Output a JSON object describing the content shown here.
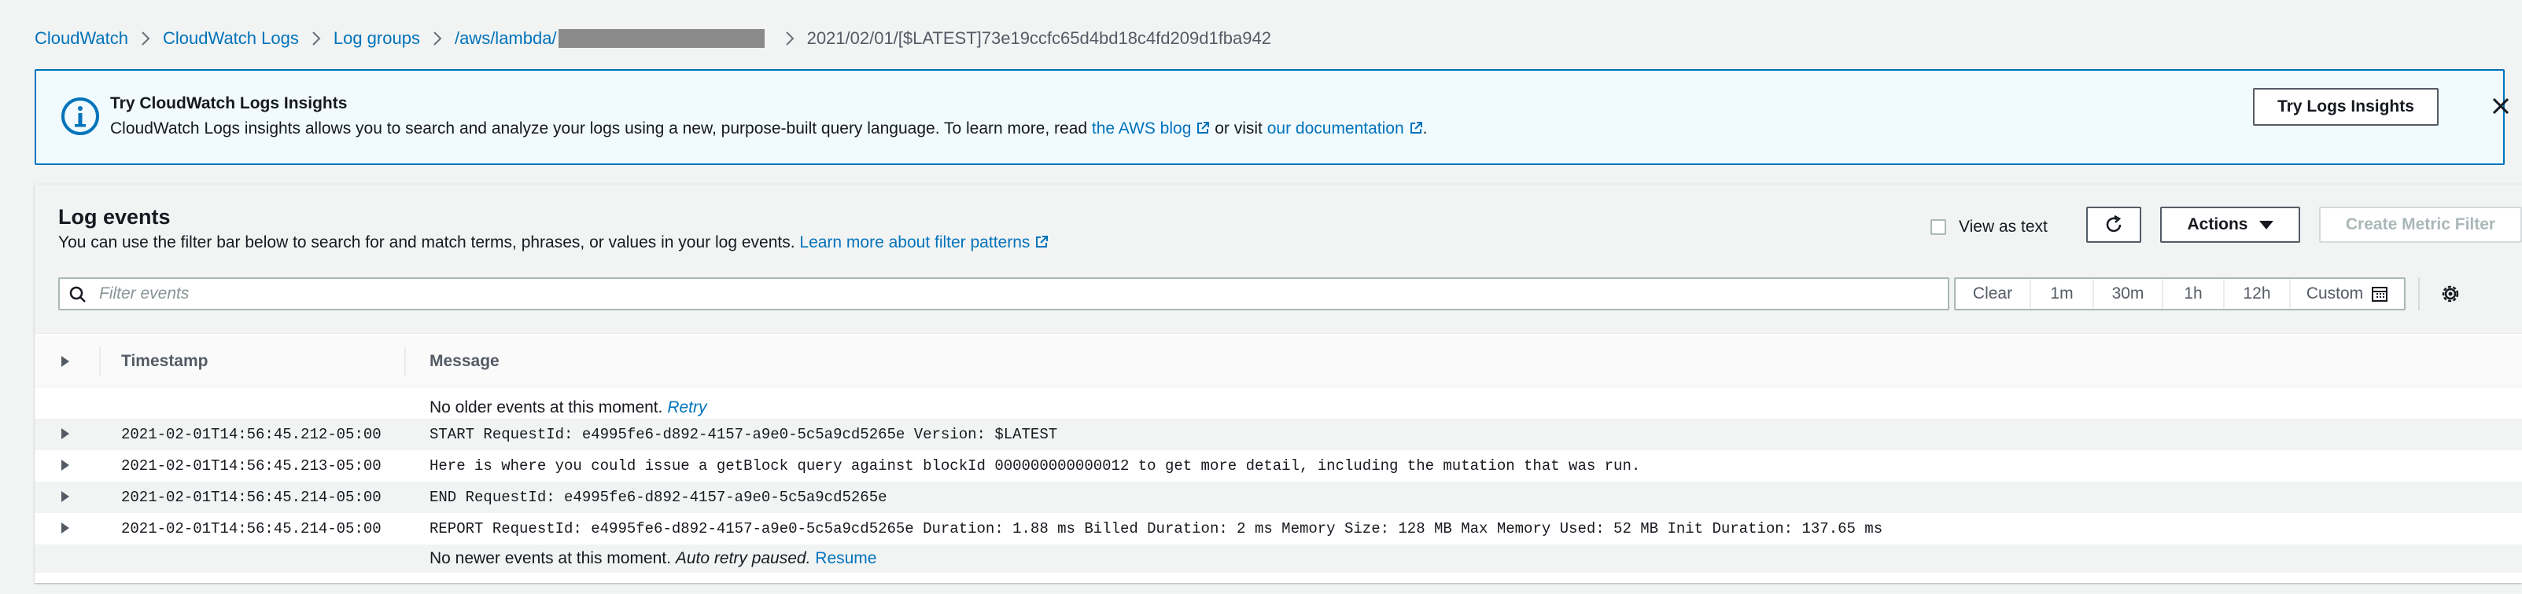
{
  "breadcrumb": {
    "items": [
      "CloudWatch",
      "CloudWatch Logs",
      "Log groups",
      "/aws/lambda/"
    ],
    "current": "2021/02/01/[$LATEST]73e19ccfc65d4bd18c4fd209d1fba942"
  },
  "banner": {
    "title": "Try CloudWatch Logs Insights",
    "body_prefix": "CloudWatch Logs insights allows you to search and analyze your logs using a new, purpose-built query language. To learn more, read ",
    "link1": "the AWS blog",
    "middle": " or visit ",
    "link2": "our documentation",
    "suffix": ".",
    "button": "Try Logs Insights"
  },
  "log_events": {
    "title": "Log events",
    "description": "You can use the filter bar below to search for and match terms, phrases, or values in your log events. ",
    "learn_more": "Learn more about filter patterns",
    "view_as_text": "View as text",
    "actions": "Actions",
    "create_metric_filter": "Create Metric Filter",
    "filter_placeholder": "Filter events",
    "time_ranges": [
      "Clear",
      "1m",
      "30m",
      "1h",
      "12h",
      "Custom"
    ]
  },
  "table": {
    "col_timestamp": "Timestamp",
    "col_message": "Message",
    "older_note": "No older events at this moment.",
    "retry": "Retry",
    "rows": [
      {
        "timestamp": "2021-02-01T14:56:45.212-05:00",
        "message": "START RequestId: e4995fe6-d892-4157-a9e0-5c5a9cd5265e Version: $LATEST"
      },
      {
        "timestamp": "2021-02-01T14:56:45.213-05:00",
        "message": "Here is where you could issue a getBlock query against blockId 000000000000012 to get more detail, including the mutation that was run."
      },
      {
        "timestamp": "2021-02-01T14:56:45.214-05:00",
        "message": "END RequestId: e4995fe6-d892-4157-a9e0-5c5a9cd5265e"
      },
      {
        "timestamp": "2021-02-01T14:56:45.214-05:00",
        "message": "REPORT RequestId: e4995fe6-d892-4157-a9e0-5c5a9cd5265e Duration: 1.88 ms Billed Duration: 2 ms Memory Size: 128 MB Max Memory Used: 52 MB Init Duration: 137.65 ms"
      }
    ],
    "newer_note": "No newer events at this moment.",
    "auto_retry": "Auto retry paused.",
    "resume": "Resume"
  },
  "colors": {
    "link": "#0073bb",
    "banner_bg": "#f1faff",
    "border": "#0073bb"
  }
}
